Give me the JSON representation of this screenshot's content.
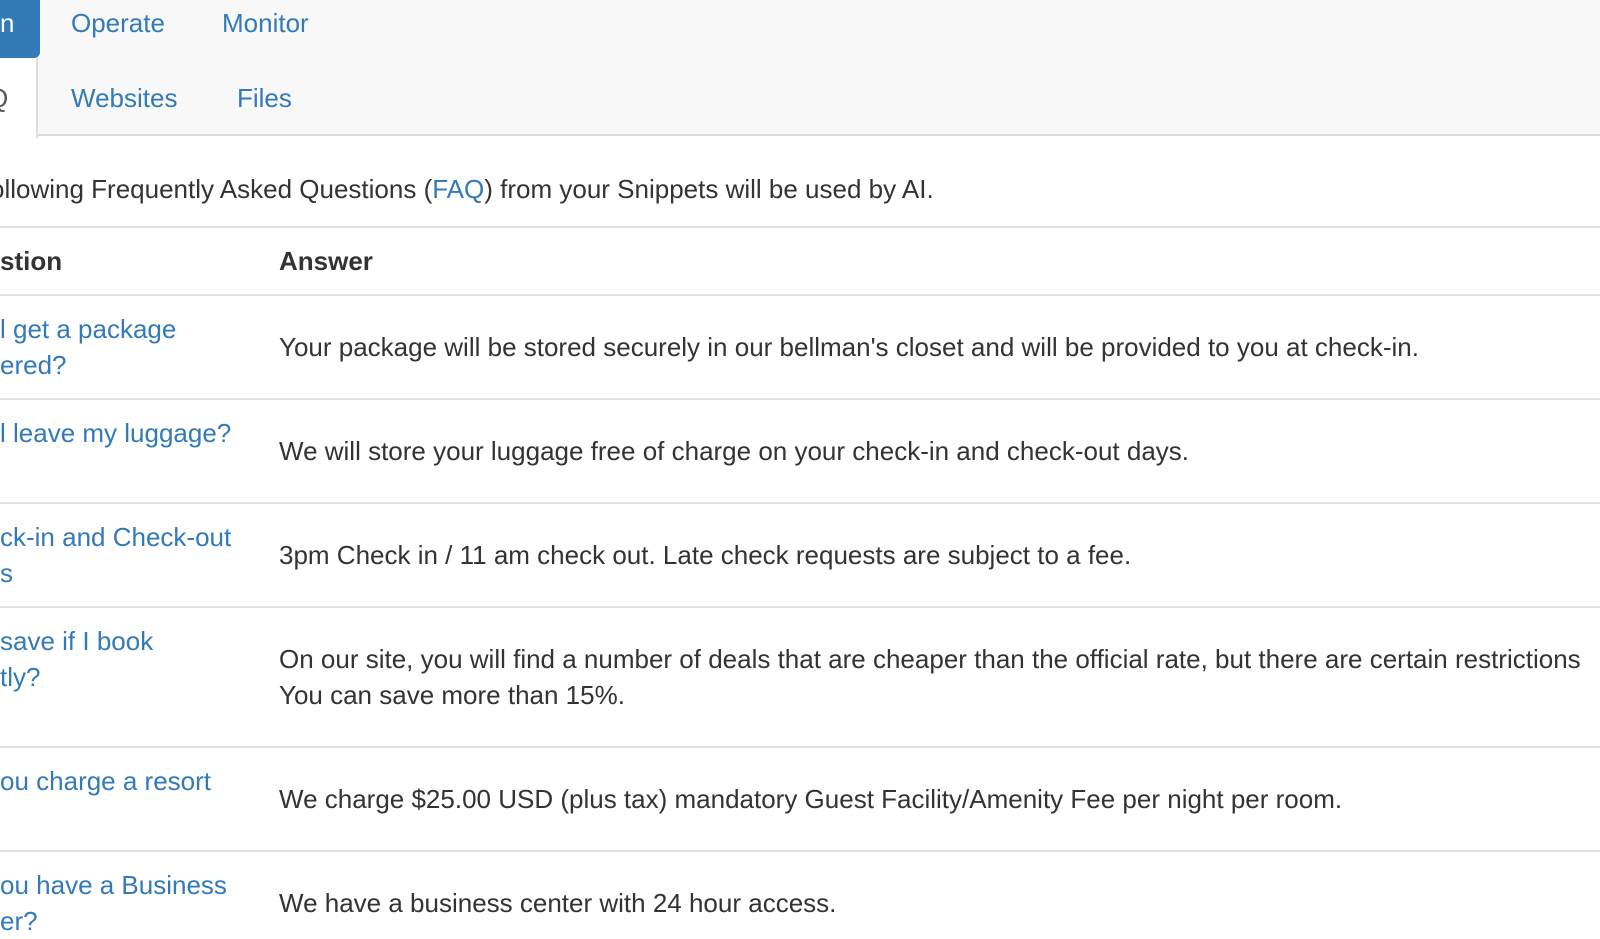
{
  "nav": {
    "active_pill": "n",
    "links": [
      "Operate",
      "Monitor"
    ],
    "subtabs_active": "Q",
    "subtabs": [
      "Websites",
      "Files"
    ]
  },
  "intro": {
    "prefix": "ollowing Frequently Asked Questions (",
    "faq_link": "FAQ",
    "suffix": ") from your Snippets will be used by AI."
  },
  "table": {
    "headers": {
      "question": "stion",
      "answer": "Answer"
    },
    "rows": [
      {
        "q1": "l get a package",
        "q2": "ered?",
        "a1": "Your package will be stored securely in our bellman's closet and will be provided to you at check-in.",
        "a2": ""
      },
      {
        "q1": "l leave my luggage?",
        "q2": "",
        "a1": "We will store your luggage free of charge on your check-in and check-out days.",
        "a2": ""
      },
      {
        "q1": "ck-in and Check-out",
        "q2": "s",
        "a1": "3pm Check in / 11 am check out. Late check requests are subject to a fee.",
        "a2": ""
      },
      {
        "q1": "save if I book",
        "q2": "tly?",
        "a1": "On our site, you will find a number of deals that are cheaper than the official rate, but there are certain restrictions",
        "a2": "You can save more than 15%."
      },
      {
        "q1": "ou charge a resort",
        "q2": "",
        "a1": "We charge $25.00 USD (plus tax) mandatory Guest Facility/Amenity Fee per night per room.",
        "a2": ""
      },
      {
        "q1": "ou have a Business",
        "q2": "er?",
        "a1": "We have a business center with 24 hour access.",
        "a2": ""
      }
    ]
  },
  "colors": {
    "link": "#337ab7",
    "text": "#333333",
    "pill": "#337ab7"
  }
}
